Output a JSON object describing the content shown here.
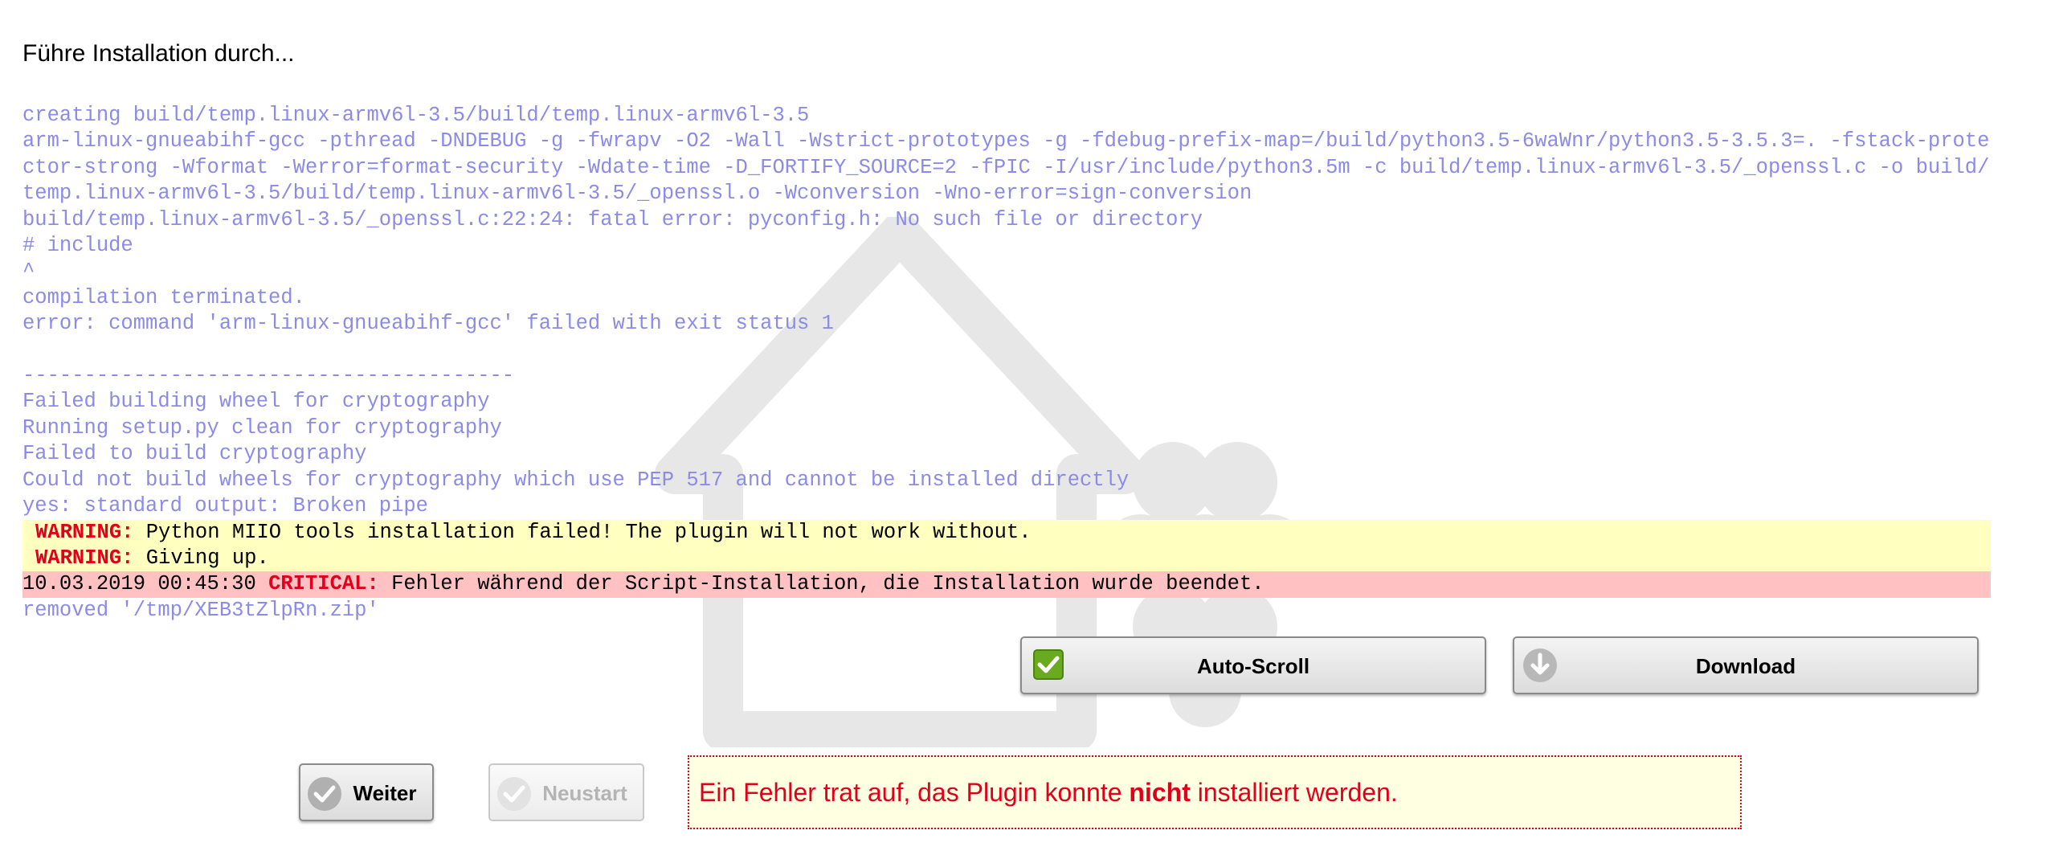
{
  "heading": "Führe Installation durch...",
  "log": {
    "lines": [
      "creating build/temp.linux-armv6l-3.5/build/temp.linux-armv6l-3.5",
      "arm-linux-gnueabihf-gcc -pthread -DNDEBUG -g -fwrapv -O2 -Wall -Wstrict-prototypes -g -fdebug-prefix-map=/build/python3.5-6waWnr/python3.5-3.5.3=. -fstack-protector-strong -Wformat -Werror=format-security -Wdate-time -D_FORTIFY_SOURCE=2 -fPIC -I/usr/include/python3.5m -c build/temp.linux-armv6l-3.5/_openssl.c -o build/temp.linux-armv6l-3.5/build/temp.linux-armv6l-3.5/_openssl.o -Wconversion -Wno-error=sign-conversion",
      "build/temp.linux-armv6l-3.5/_openssl.c:22:24: fatal error: pyconfig.h: No such file or directory",
      "# include",
      "^",
      "compilation terminated.",
      "error: command 'arm-linux-gnueabihf-gcc' failed with exit status 1",
      "",
      "----------------------------------------",
      "Failed building wheel for cryptography",
      "Running setup.py clean for cryptography",
      "Failed to build cryptography",
      "Could not build wheels for cryptography which use PEP 517 and cannot be installed directly",
      "yes: standard output: Broken pipe"
    ],
    "warnings": [
      {
        "tag": "WARNING:",
        "text": " Python MIIO tools installation failed! The plugin will not work without."
      },
      {
        "tag": "WARNING:",
        "text": " Giving up."
      }
    ],
    "critical": {
      "timestamp": "10.03.2019 00:45:30 ",
      "tag": "CRITICAL:",
      "text": " Fehler während der Script-Installation, die Installation wurde beendet."
    },
    "last_line": "removed '/tmp/XEB3tZlpRn.zip'"
  },
  "buttons": {
    "autoscroll": {
      "label": "Auto-Scroll",
      "icon": "checkbox-checked-icon",
      "checked": true
    },
    "download": {
      "label": "Download",
      "icon": "download-arrow-icon"
    },
    "weiter": {
      "label": "Weiter",
      "icon": "checkmark-circle-icon"
    },
    "neustart": {
      "label": "Neustart",
      "icon": "checkmark-circle-icon",
      "disabled": true
    }
  },
  "error_message": {
    "before": "Ein Fehler trat auf, das Plugin konnte ",
    "emphasis": "nicht",
    "after": " installiert werden."
  },
  "colors": {
    "log_text": "#8b8be6",
    "warning_bg": "#ffffc0",
    "critical_bg": "#ffc1c1",
    "error_red": "#e0001c",
    "checkbox_green": "#6aaa1e"
  }
}
